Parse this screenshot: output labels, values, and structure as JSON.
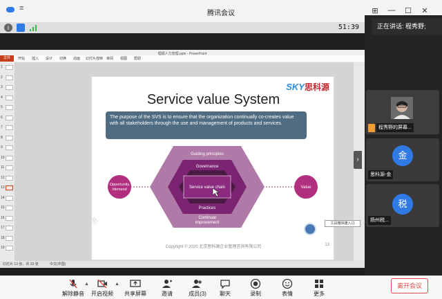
{
  "window": {
    "title": "腾讯会议"
  },
  "infobar": {
    "timer": "51:39"
  },
  "ppt": {
    "filename": "理顺人力管理.pptx - PowerPoint",
    "file_tab": "文件",
    "tabs": [
      "开始",
      "插入",
      "设计",
      "切换",
      "动画",
      "幻灯片放映",
      "审阅",
      "视图",
      "帮助"
    ],
    "thumb_numbers": [
      "1",
      "2",
      "3",
      "4",
      "5",
      "6",
      "7",
      "8",
      "9",
      "10",
      "11",
      "12",
      "13",
      "14",
      "15",
      "16",
      "17",
      "18",
      "19"
    ],
    "status_slide": "幻灯片 13 张，共 33 张",
    "status_lang": "中文(中国)"
  },
  "slide": {
    "title": "Service value System",
    "logo_latin": "SKY",
    "logo_cn": "思科源",
    "purpose_text": "The purpose of the SVS is to ensure that the organization continually co-creates value with all stakeholders through the use and management of products and services.",
    "guiding_principles": "Guiding principles",
    "governance": "Governance",
    "service_value_chain": "Service value chain",
    "practices": "Practices",
    "continual_improvement_1": "Continual",
    "continual_improvement_2": "improvement",
    "opportunity_1": "Opportunity",
    "opportunity_2": "/demand",
    "value": "Value",
    "copyright": "Copyright © 2020 北京思科源企业管理咨询有限公司",
    "slide_number": "13",
    "watermark": "思"
  },
  "floating": {
    "chip_label": "工具箱快捷入口"
  },
  "right_panel": {
    "speaking_label": "正在讲话: 程秀野;",
    "tiles": [
      {
        "name": "程秀野的屏幕..."
      },
      {
        "name": "思科源-金",
        "avatar": "金"
      },
      {
        "name": "扬州税...",
        "avatar": "税"
      }
    ]
  },
  "toolbar": {
    "mute": "解除静音",
    "video": "开启视频",
    "share": "共享屏幕",
    "invite": "邀请",
    "members": "成员(3)",
    "chat": "聊天",
    "record": "录制",
    "reactions": "表情",
    "more": "更多",
    "leave": "离开会议"
  },
  "colors": {
    "hex_dark": "#4a1a45",
    "hex_mid": "#8b2a7e",
    "hex_light": "#b07aa8",
    "circle": "#b0307f",
    "purpose_bg": "#4f6c82",
    "leave_red": "#e24a4a"
  }
}
